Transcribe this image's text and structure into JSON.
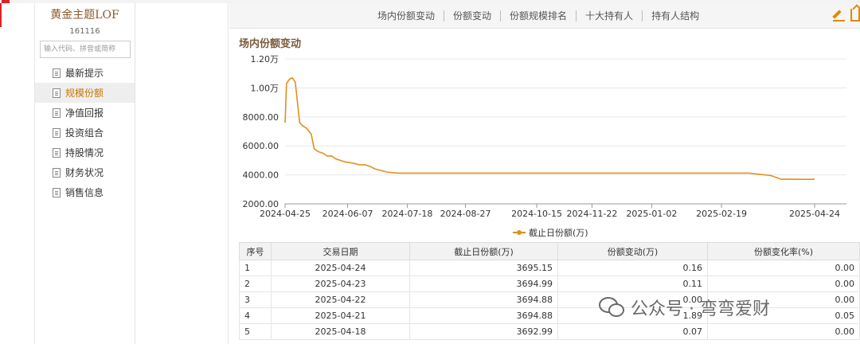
{
  "sidebar": {
    "fund_name": "黄金主题LOF",
    "fund_code": "161116",
    "search_placeholder": "输入代码、拼音或简称",
    "items": [
      {
        "label": "最新提示",
        "active": false
      },
      {
        "label": "规模份额",
        "active": true
      },
      {
        "label": "净值回报",
        "active": false
      },
      {
        "label": "投资组合",
        "active": false
      },
      {
        "label": "持股情况",
        "active": false
      },
      {
        "label": "财务状况",
        "active": false
      },
      {
        "label": "销售信息",
        "active": false
      }
    ]
  },
  "tabs": [
    "场内份额变动",
    "份额变动",
    "份额规模排名",
    "十大持有人",
    "持有人结构"
  ],
  "section_title": "场内份额变动",
  "chart_data": {
    "type": "line",
    "title": "",
    "xlabel": "",
    "ylabel": "",
    "y_ticks": [
      "1.20万",
      "1.00万",
      "8000.00",
      "6000.00",
      "4000.00",
      "2000.00"
    ],
    "y_tick_values": [
      12000,
      10000,
      8000,
      6000,
      4000,
      2000
    ],
    "ylim": [
      2000,
      12000
    ],
    "x_ticks": [
      "2024-04-25",
      "2024-06-07",
      "2024-07-18",
      "2024-08-27",
      "2024-10-15",
      "2024-11-22",
      "2025-01-02",
      "2025-02-19",
      "2025-04-24"
    ],
    "legend": "截止日份额(万)",
    "color": "#e0901a",
    "series": [
      {
        "name": "截止日份额(万)",
        "x": [
          "2024-04-25",
          "2024-04-26",
          "2024-04-28",
          "2024-04-30",
          "2024-05-02",
          "2024-05-05",
          "2024-05-07",
          "2024-05-10",
          "2024-05-13",
          "2024-05-15",
          "2024-05-18",
          "2024-05-21",
          "2024-05-24",
          "2024-05-27",
          "2024-05-30",
          "2024-06-02",
          "2024-06-05",
          "2024-06-08",
          "2024-06-11",
          "2024-06-15",
          "2024-06-19",
          "2024-06-22",
          "2024-06-26",
          "2024-06-30",
          "2024-07-04",
          "2024-07-08",
          "2024-07-12",
          "2024-07-16",
          "2024-07-20",
          "2024-12-15",
          "2025-02-28",
          "2025-03-10",
          "2025-03-25",
          "2025-04-01",
          "2025-04-18",
          "2025-04-21",
          "2025-04-22",
          "2025-04-23",
          "2025-04-24"
        ],
        "y": [
          7600,
          10300,
          10600,
          10700,
          10400,
          7600,
          7400,
          7200,
          6800,
          5800,
          5600,
          5500,
          5300,
          5300,
          5100,
          5000,
          4900,
          4850,
          4800,
          4700,
          4700,
          4600,
          4400,
          4300,
          4200,
          4150,
          4120,
          4120,
          4120,
          4120,
          4120,
          4120,
          3950,
          3700,
          3692.99,
          3694.88,
          3694.88,
          3694.99,
          3695.15
        ]
      }
    ]
  },
  "table": {
    "headers": [
      "序号",
      "交易日期",
      "截止日份额(万)",
      "份额变动(万)",
      "份额变化率(%)"
    ],
    "rows": [
      {
        "idx": "1",
        "date": "2025-04-24",
        "shares": "3695.15",
        "change": "0.16",
        "rate": "0.00"
      },
      {
        "idx": "2",
        "date": "2025-04-23",
        "shares": "3694.99",
        "change": "0.11",
        "rate": "0.00"
      },
      {
        "idx": "3",
        "date": "2025-04-22",
        "shares": "3694.88",
        "change": "0.00",
        "rate": "0.00"
      },
      {
        "idx": "4",
        "date": "2025-04-21",
        "shares": "3694.88",
        "change": "1.89",
        "rate": "0.05"
      },
      {
        "idx": "5",
        "date": "2025-04-18",
        "shares": "3692.99",
        "change": "0.07",
        "rate": "0.00"
      }
    ]
  },
  "watermark": "公众号 · 弯弯爱财"
}
